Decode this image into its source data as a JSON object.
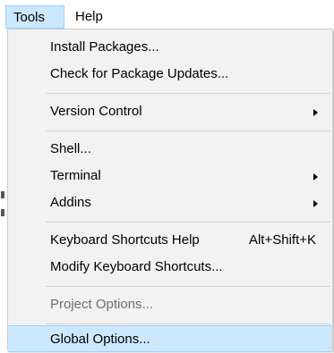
{
  "menubar": {
    "tools_label": "Tools",
    "help_label": "Help"
  },
  "menu": {
    "install_packages": "Install Packages...",
    "check_updates": "Check for Package Updates...",
    "version_control": "Version Control",
    "shell": "Shell...",
    "terminal": "Terminal",
    "addins": "Addins",
    "keyboard_shortcuts_help": "Keyboard Shortcuts Help",
    "keyboard_shortcuts_help_shortcut": "Alt+Shift+K",
    "modify_keyboard_shortcuts": "Modify Keyboard Shortcuts...",
    "project_options": "Project Options...",
    "global_options": "Global Options..."
  },
  "colors": {
    "highlight_bg": "#cce8ff",
    "highlight_border": "#99d1ff",
    "menu_bg": "#f2f2f2",
    "disabled_text": "#6d6d6d"
  },
  "icons": {
    "submenu_arrow": "chevron-right-icon"
  }
}
